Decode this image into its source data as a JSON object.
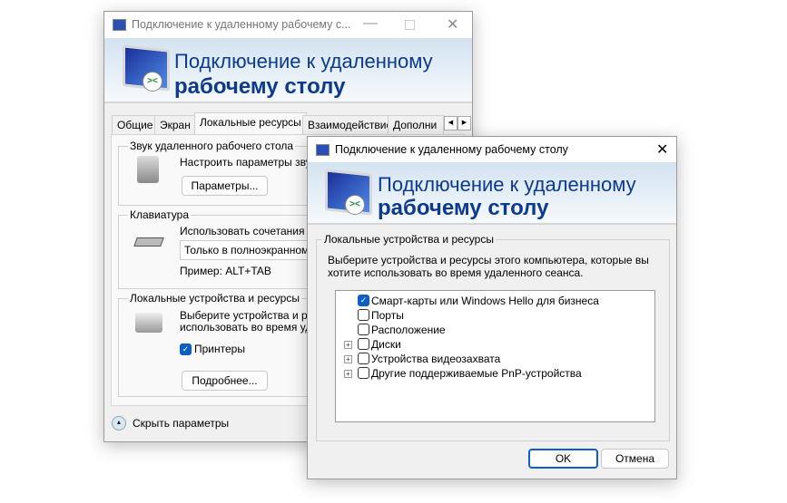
{
  "back": {
    "title": "Подключение к удаленному рабочему с...",
    "banner_line1": "Подключение к удаленному",
    "banner_line2": "рабочему столу",
    "tabs": [
      "Общие",
      "Экран",
      "Локальные ресурсы",
      "Взаимодействие",
      "Дополни"
    ],
    "sound": {
      "legend": "Звук удаленного рабочего стола",
      "text": "Настроить параметры звука",
      "button": "Параметры..."
    },
    "keyboard": {
      "legend": "Клавиатура",
      "text": "Использовать сочетания кл",
      "select": "Только в полноэкранном р",
      "example": "Пример: ALT+TAB"
    },
    "local": {
      "legend": "Локальные устройства и ресурсы",
      "text1": "Выберите устройства и ресу",
      "text2": "использовать во время удал",
      "printers": "Принтеры",
      "printers_checked": true,
      "button": "Подробнее..."
    },
    "hide": "Скрыть параметры"
  },
  "front": {
    "title": "Подключение к удаленному рабочему столу",
    "banner_line1": "Подключение к удаленному",
    "banner_line2": "рабочему столу",
    "legend": "Локальные устройства и ресурсы",
    "desc1": "Выберите устройства и ресурсы этого компьютера, которые вы",
    "desc2": "хотите использовать во время удаленного сеанса.",
    "items": [
      {
        "label": "Смарт-карты или Windows Hello для бизнеса",
        "checked": true,
        "expandable": false
      },
      {
        "label": "Порты",
        "checked": false,
        "expandable": false
      },
      {
        "label": "Расположение",
        "checked": false,
        "expandable": false
      },
      {
        "label": "Диски",
        "checked": false,
        "expandable": true
      },
      {
        "label": "Устройства видеозахвата",
        "checked": false,
        "expandable": true
      },
      {
        "label": "Другие поддерживаемые PnP-устройства",
        "checked": false,
        "expandable": true
      }
    ],
    "ok": "OK",
    "cancel": "Отмена"
  },
  "accent": "#0f5ec4",
  "banner_text_color": "#0b3a8f"
}
